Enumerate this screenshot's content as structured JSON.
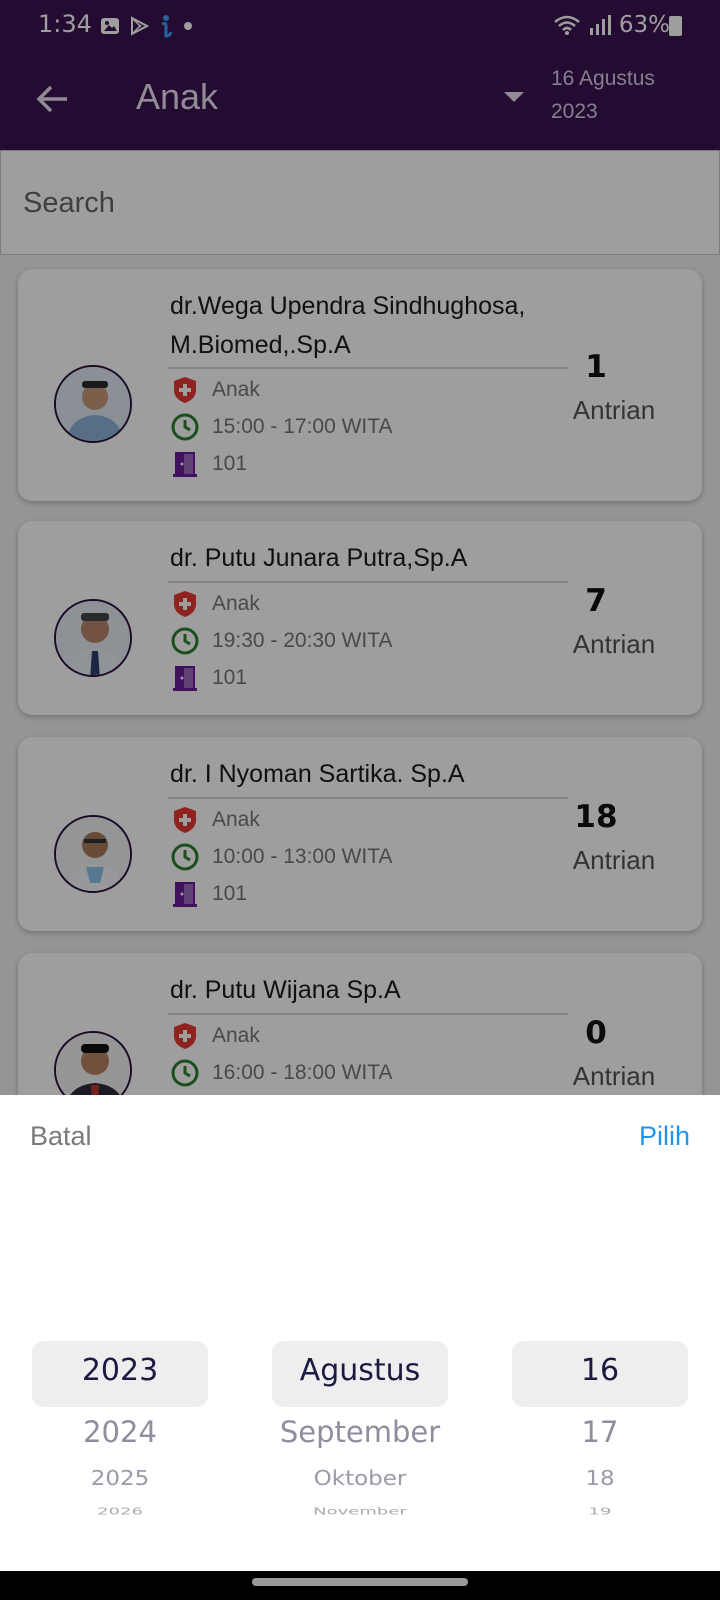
{
  "status_bar": {
    "time": "1:34",
    "battery": "63%",
    "icons": [
      "gallery-icon",
      "play-store-icon",
      "app-notification-icon",
      "dot-icon",
      "wifi-icon",
      "signal-icon",
      "battery-icon"
    ]
  },
  "app_bar": {
    "title": "Anak",
    "date": "16 Agustus 2023"
  },
  "search": {
    "placeholder": "Search"
  },
  "doctors": [
    {
      "name": "dr.Wega Upendra Sindhughosa, M.Biomed,.Sp.A",
      "specialty": "Anak",
      "time": "15:00 - 17:00 WITA",
      "room": "101",
      "queue": "1",
      "queue_label": "Antrian"
    },
    {
      "name": "dr. Putu Junara Putra,Sp.A",
      "specialty": "Anak",
      "time": "19:30 - 20:30 WITA",
      "room": "101",
      "queue": "7",
      "queue_label": "Antrian"
    },
    {
      "name": "dr. I Nyoman Sartika. Sp.A",
      "specialty": "Anak",
      "time": "10:00 - 13:00 WITA",
      "room": "101",
      "queue": "18",
      "queue_label": "Antrian"
    },
    {
      "name": "dr. Putu Wijana Sp.A",
      "specialty": "Anak",
      "time": "16:00 - 18:00 WITA",
      "room": "",
      "queue": "0",
      "queue_label": "Antrian"
    }
  ],
  "picker": {
    "cancel_label": "Batal",
    "confirm_label": "Pilih",
    "years": [
      "2023",
      "2024",
      "2025",
      "2026"
    ],
    "months": [
      "Agustus",
      "September",
      "Oktober",
      "November"
    ],
    "days": [
      "16",
      "17",
      "18",
      "19"
    ]
  },
  "colors": {
    "app_bar": "#3b1250",
    "accent_blue": "#2196e8",
    "specialty_icon": "#e53935",
    "clock_icon": "#2e7d32",
    "door_icon": "#6a1b9a"
  }
}
